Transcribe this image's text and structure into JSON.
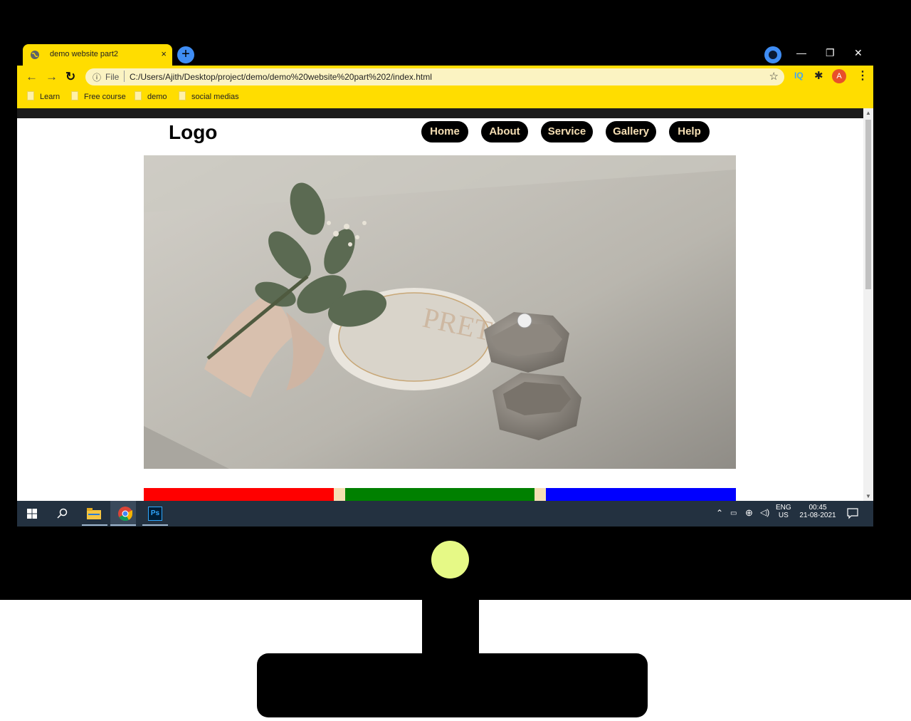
{
  "browser": {
    "tab_title": "demo website part2",
    "tab_close": "×",
    "new_tab": "+",
    "window_controls": {
      "minimize": "—",
      "restore": "❐",
      "close": "✕"
    },
    "omnibox": {
      "info_icon": "ⓘ",
      "scheme_label": "File",
      "url": "C:/Users/Ajith/Desktop/project/demo/demo%20website%20part%202/index.html",
      "star_icon": "☆"
    },
    "extensions": {
      "iq_label": "IQ",
      "avatar_letter": "A"
    },
    "bookmarks": [
      {
        "label": "Learn"
      },
      {
        "label": "Free course"
      },
      {
        "label": "demo"
      },
      {
        "label": "social medias"
      }
    ],
    "accent_color": "#ffdd00"
  },
  "site": {
    "logo": "Logo",
    "nav": [
      {
        "label": "Home"
      },
      {
        "label": "About"
      },
      {
        "label": "Service"
      },
      {
        "label": "Gallery"
      },
      {
        "label": "Help"
      }
    ],
    "nav_text_color": "#f5deb3",
    "cards": [
      {
        "color": "#ff0000"
      },
      {
        "color": "#008000"
      },
      {
        "color": "#0000ff"
      }
    ]
  },
  "taskbar": {
    "apps": [
      {
        "icon": "windows-start-icon"
      },
      {
        "icon": "search-icon"
      },
      {
        "icon": "file-explorer-icon"
      },
      {
        "icon": "chrome-icon"
      },
      {
        "icon": "photoshop-icon",
        "label": "Ps"
      }
    ],
    "tray": {
      "language_top": "ENG",
      "language_bottom": "US",
      "time": "00:45",
      "date": "21-08-2021"
    }
  },
  "monitor": {
    "bezel_color": "#000000",
    "power_button_color": "#e6f986"
  }
}
